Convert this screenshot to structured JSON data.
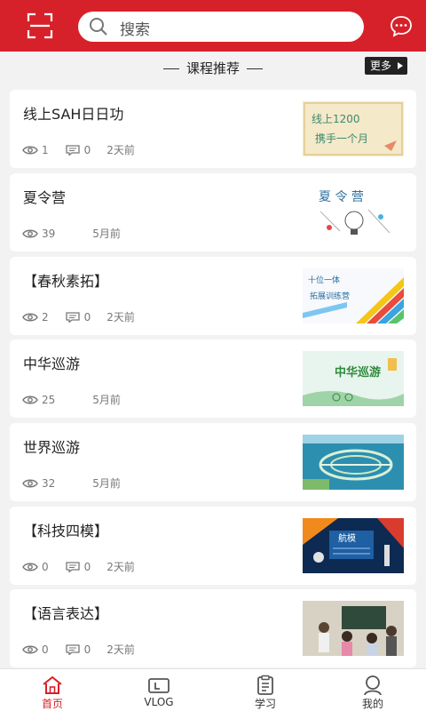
{
  "header": {
    "search_placeholder": "搜索"
  },
  "section": {
    "title": "课程推荐",
    "more_label": "更多"
  },
  "courses": [
    {
      "title": "线上SAH日日功",
      "views": "1",
      "comments": "0",
      "time": "2天前",
      "thumb_text": "线上1200 一个月"
    },
    {
      "title": "夏令营",
      "views": "39",
      "comments": "",
      "time": "5月前",
      "thumb_text": "夏 令 营"
    },
    {
      "title": "【春秋素拓】",
      "views": "2",
      "comments": "0",
      "time": "2天前",
      "thumb_text": "十位一体 拓展训练营"
    },
    {
      "title": "中华巡游",
      "views": "25",
      "comments": "",
      "time": "5月前",
      "thumb_text": "中华巡游"
    },
    {
      "title": "世界巡游",
      "views": "32",
      "comments": "",
      "time": "5月前",
      "thumb_text": ""
    },
    {
      "title": "【科技四模】",
      "views": "0",
      "comments": "0",
      "time": "2天前",
      "thumb_text": "航模"
    },
    {
      "title": "【语言表达】",
      "views": "0",
      "comments": "0",
      "time": "2天前",
      "thumb_text": ""
    }
  ],
  "tabbar": {
    "items": [
      {
        "label": "首页",
        "icon": "home-icon",
        "active": true
      },
      {
        "label": "VLOG",
        "icon": "video-icon",
        "active": false
      },
      {
        "label": "学习",
        "icon": "clipboard-icon",
        "active": false
      },
      {
        "label": "我的",
        "icon": "user-icon",
        "active": false
      }
    ]
  },
  "colors": {
    "brand": "#d7212a",
    "background": "#f2f2f2"
  }
}
